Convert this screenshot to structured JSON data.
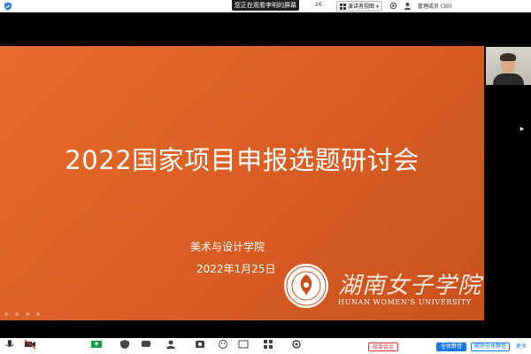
{
  "topbar": {
    "view_banner": "您正在观看李明的屏幕",
    "timer": "26",
    "speaker_view": "演讲者视图",
    "host_info": "管理成员 (30)"
  },
  "slide": {
    "title": "2022国家项目申报选题研讨会",
    "department": "美术与设计学院",
    "date": "2022年1月25日",
    "university_cn": "湖南女子学院",
    "university_en": "HUNAN WOMEN’S UNIVERSITY"
  },
  "toolbar": {
    "end_label": "结束会议",
    "mute_all_label": "全体静音",
    "unmute_all_label": "解除全体静音",
    "more_label": "更多"
  },
  "colors": {
    "slide_orange": "#d85e24",
    "end_red": "#d33333",
    "accent_blue": "#1677e5"
  }
}
